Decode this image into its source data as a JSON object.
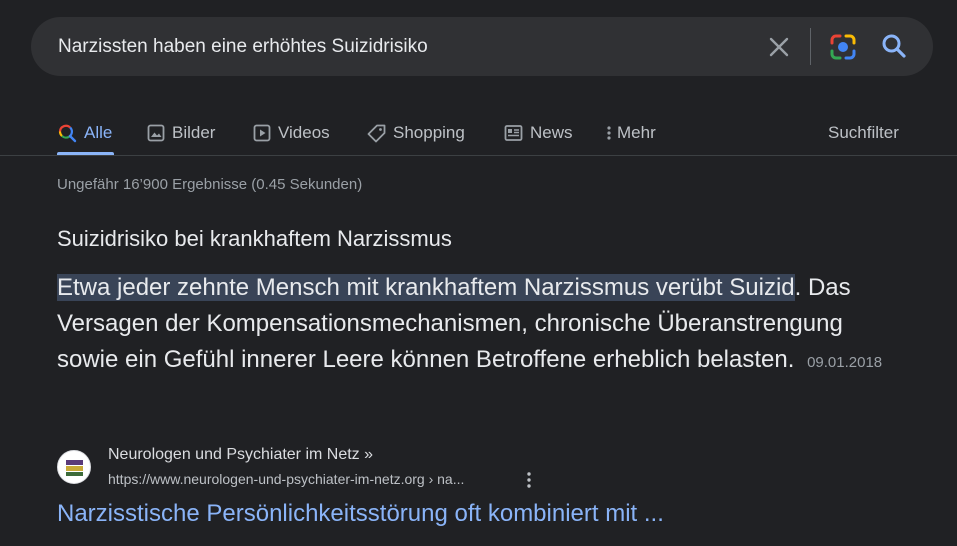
{
  "search": {
    "query": "Narzissten haben eine erhöhtes Suizidrisiko"
  },
  "tabs": [
    {
      "label": "Alle",
      "icon": "search-icon",
      "active": true
    },
    {
      "label": "Bilder",
      "icon": "image-icon"
    },
    {
      "label": "Videos",
      "icon": "play-icon"
    },
    {
      "label": "Shopping",
      "icon": "tag-icon"
    },
    {
      "label": "News",
      "icon": "newspaper-icon"
    },
    {
      "label": "Mehr",
      "icon": "more-vert-icon"
    }
  ],
  "filter_label": "Suchfilter",
  "stats": "Ungefähr 16’900 Ergebnisse (0.45 Sekunden)",
  "featured": {
    "title": "Suizidrisiko bei krankhaftem Narzissmus",
    "highlight": "Etwa jeder zehnte Mensch mit krankhaftem Narzissmus verübt Suizid",
    "rest": ". Das Versagen der Kompensationsmechanismen, chronische Überanstrengung sowie ein Gefühl innerer Leere können Betroffene erheblich belasten.",
    "date": "09.01.2018"
  },
  "source": {
    "name": "Neurologen und Psychiater im Netz »",
    "url": "https://www.neurologen-und-psychiater-im-netz.org › na..."
  },
  "result": {
    "title": "Narzisstische Persönlichkeitsstörung oft kombiniert mit ..."
  },
  "colors": {
    "background": "#202124",
    "searchbar": "#303134",
    "link": "#8ab4f8",
    "highlight": "#394457"
  }
}
